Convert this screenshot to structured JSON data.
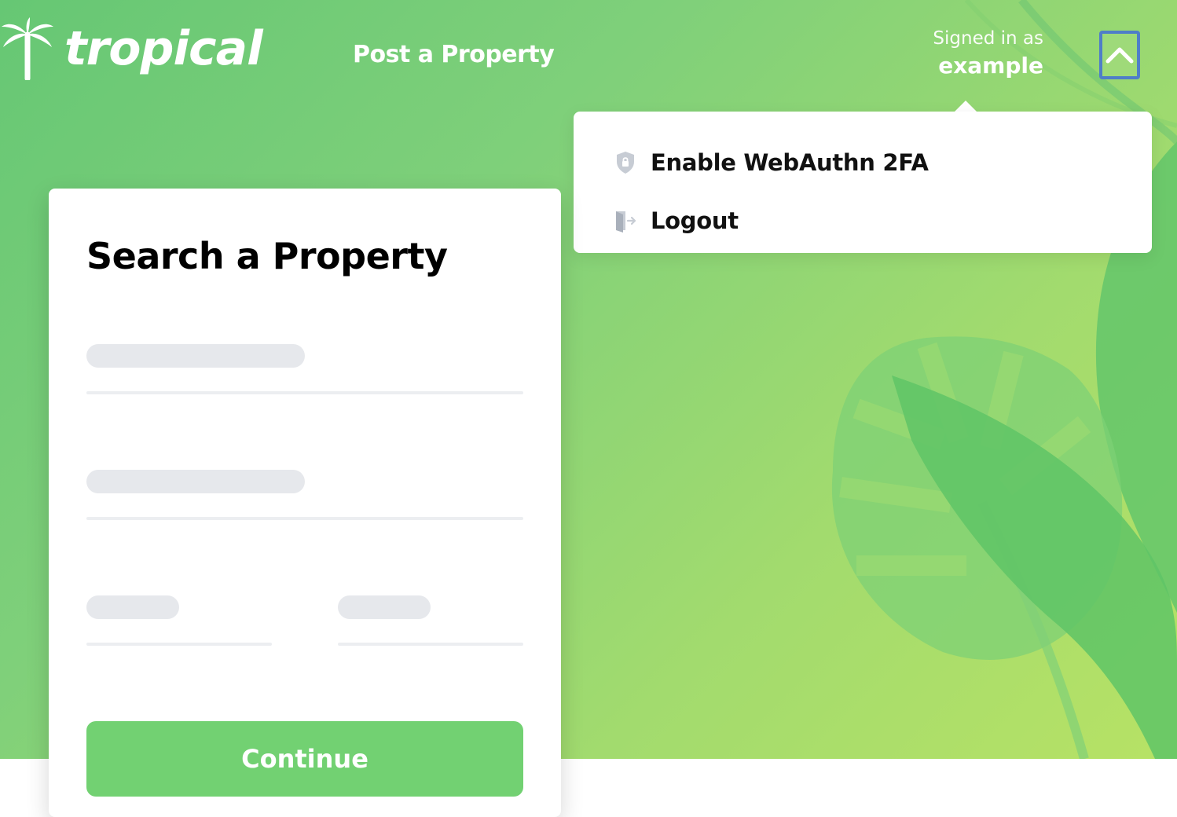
{
  "brand": {
    "name": "tropical",
    "logo_icon": "palm-tree-icon"
  },
  "nav": {
    "post_property": "Post a Property"
  },
  "account": {
    "signed_in_caption": "Signed in as",
    "username": "example",
    "toggle_icon": "chevron-up-icon"
  },
  "dropdown": {
    "items": [
      {
        "label": "Enable WebAuthn 2FA",
        "icon": "shield-lock-icon"
      },
      {
        "label": "Logout",
        "icon": "logout-door-icon"
      }
    ]
  },
  "search_card": {
    "title": "Search a Property",
    "continue_label": "Continue"
  },
  "colors": {
    "hero_gradient_start": "#66c774",
    "hero_gradient_end": "#b7e265",
    "button_green": "#72d172",
    "focus_outline": "#4f7ec8",
    "skeleton": "#e6e8ec"
  }
}
